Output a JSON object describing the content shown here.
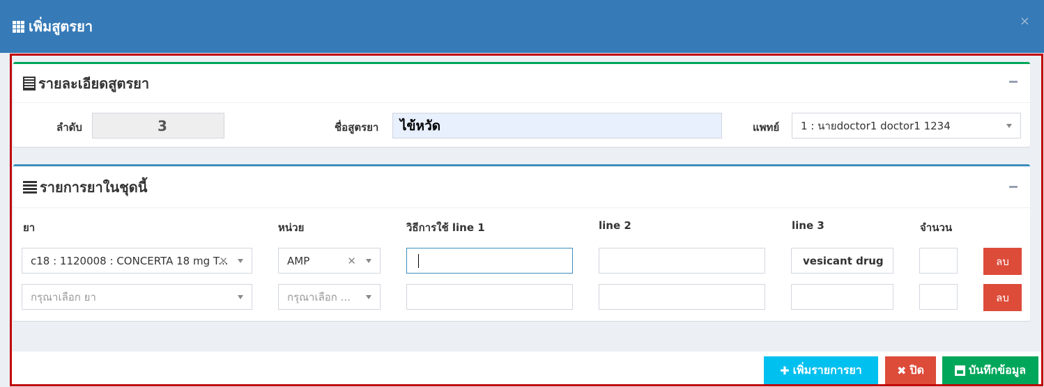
{
  "modal": {
    "title": "เพิ่มสูตรยา",
    "close": "×"
  },
  "details": {
    "title": "รายละเอียดสูตรยา",
    "order_label": "ลำดับ",
    "order_value": "3",
    "name_label": "ชื่อสูตรยา",
    "name_value": "ไข้หวัด",
    "doctor_label": "แพทย์",
    "doctor_value": "1 : นายdoctor1 doctor1 1234"
  },
  "items": {
    "title": "รายการยาในชุดนี้",
    "headers": {
      "drug": "ยา",
      "unit": "หน่วย",
      "line1": "วิธีการใช้ line 1",
      "line2": "line 2",
      "line3": "line 3",
      "qty": "จำนวน"
    },
    "rows": [
      {
        "drug": "c18 : 1120008 : CONCERTA 18 mg T...",
        "unit": "AMP",
        "line1": "",
        "line2": "",
        "line3": "vesicant drug",
        "qty": "",
        "delete": "ลบ"
      },
      {
        "drug_placeholder": "กรุณาเลือก ยา",
        "unit_placeholder": "กรุณาเลือก ...",
        "line1": "",
        "line2": "",
        "line3": "",
        "qty": "",
        "delete": "ลบ"
      }
    ]
  },
  "footer": {
    "add": "เพิ่มรายการยา",
    "close": "ปิด",
    "save": "บันทึกข้อมูล"
  },
  "colors": {
    "header": "#367ab7",
    "success": "#00a65a",
    "danger": "#dd4b39",
    "info": "#00c0ef",
    "frame": "#c00000"
  }
}
